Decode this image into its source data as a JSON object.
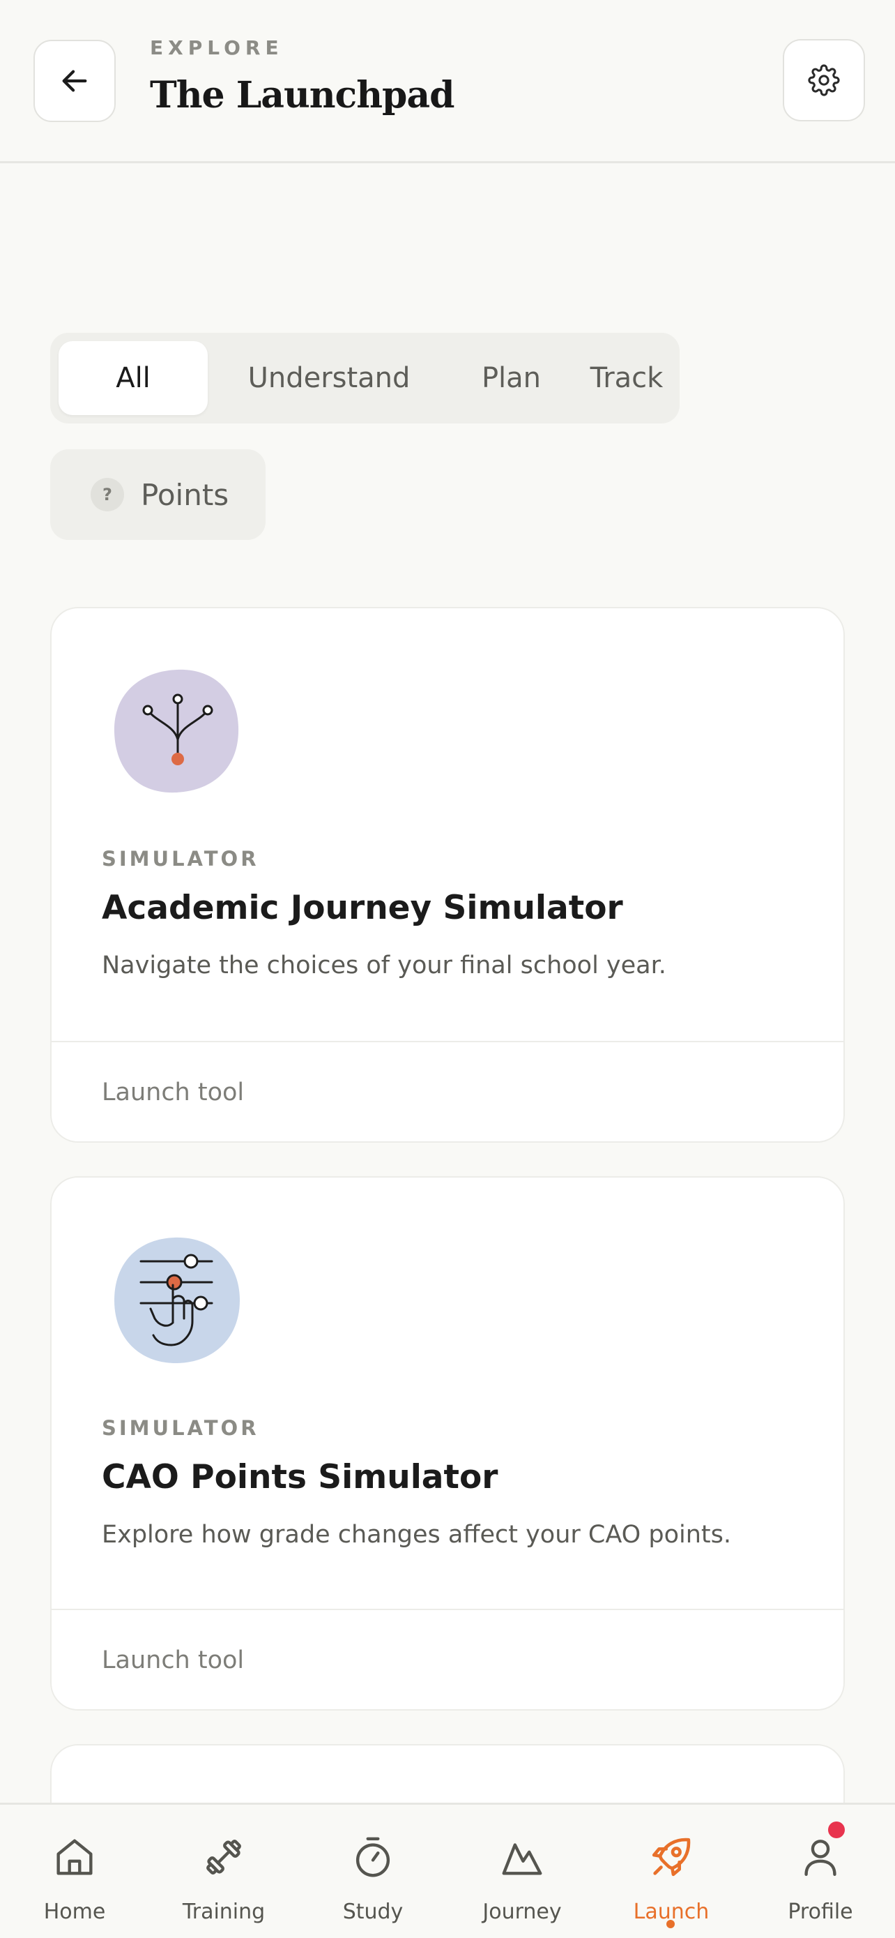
{
  "header": {
    "eyebrow": "EXPLORE",
    "title": "The Launchpad",
    "back_icon": "arrow-left-icon",
    "settings_icon": "gear-icon"
  },
  "filters": {
    "segments": [
      {
        "label": "All",
        "active": true
      },
      {
        "label": "Understand",
        "active": false
      },
      {
        "label": "Plan",
        "active": false
      },
      {
        "label": "Track",
        "active": false
      }
    ],
    "chip": {
      "icon_text": "?",
      "label": "Points"
    }
  },
  "cards": [
    {
      "kicker": "SIMULATOR",
      "title": "Academic Journey Simulator",
      "description": "Navigate the choices of your final school year.",
      "action": "Launch tool",
      "illustration": "branching-path-icon",
      "blob_color": "#d3cde3"
    },
    {
      "kicker": "SIMULATOR",
      "title": "CAO Points Simulator",
      "description": "Explore how grade changes affect your CAO points.",
      "action": "Launch tool",
      "illustration": "sliders-hand-icon",
      "blob_color": "#c8d6ea"
    }
  ],
  "tabbar": {
    "items": [
      {
        "label": "Home",
        "icon": "home-icon",
        "active": false
      },
      {
        "label": "Training",
        "icon": "dumbbell-icon",
        "active": false
      },
      {
        "label": "Study",
        "icon": "stopwatch-icon",
        "active": false
      },
      {
        "label": "Journey",
        "icon": "mountain-icon",
        "active": false
      },
      {
        "label": "Launch",
        "icon": "rocket-icon",
        "active": true
      },
      {
        "label": "Profile",
        "icon": "user-icon",
        "active": false
      }
    ],
    "accent_color": "#e8702a",
    "notification_color": "#e8344e"
  }
}
